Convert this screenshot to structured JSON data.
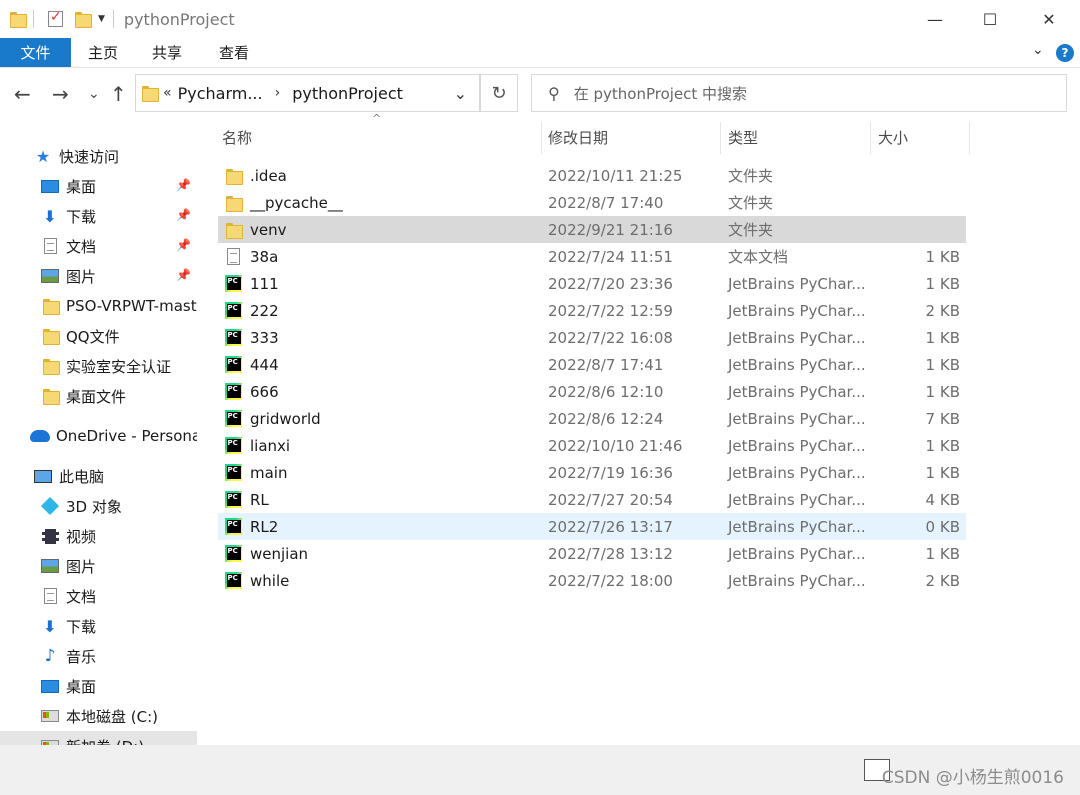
{
  "titlebar": {
    "title": "pythonProject",
    "minimize": "—",
    "maximize": "☐",
    "close": "✕"
  },
  "ribbon": {
    "tabs": [
      "文件",
      "主页",
      "共享",
      "查看"
    ],
    "expand": "⌄",
    "help": "?"
  },
  "nav": {
    "back": "←",
    "forward": "→",
    "recent": "⌄",
    "up": "↑",
    "address_prefix": "«",
    "breadcrumb": [
      "Pycharm...",
      "pythonProject"
    ],
    "address_dropdown": "⌄",
    "refresh": "↻",
    "search_placeholder": "在 pythonProject 中搜索"
  },
  "sidebar": {
    "items": [
      {
        "label": "快速访问",
        "icon": "star-icon"
      },
      {
        "label": "桌面",
        "icon": "desktop-icon",
        "pinned": true
      },
      {
        "label": "下载",
        "icon": "download-icon",
        "pinned": true
      },
      {
        "label": "文档",
        "icon": "document-icon",
        "pinned": true
      },
      {
        "label": "图片",
        "icon": "pictures-icon",
        "pinned": true
      },
      {
        "label": "PSO-VRPWT-mast",
        "icon": "folder-icon"
      },
      {
        "label": "QQ文件",
        "icon": "folder-icon"
      },
      {
        "label": "实验室安全认证",
        "icon": "folder-icon"
      },
      {
        "label": "桌面文件",
        "icon": "folder-icon"
      },
      {
        "label": "OneDrive - Persona",
        "icon": "onedrive-icon"
      },
      {
        "label": "此电脑",
        "icon": "this-pc-icon"
      },
      {
        "label": "3D 对象",
        "icon": "3d-objects-icon"
      },
      {
        "label": "视频",
        "icon": "videos-icon"
      },
      {
        "label": "图片",
        "icon": "pictures-icon"
      },
      {
        "label": "文档",
        "icon": "document-icon"
      },
      {
        "label": "下载",
        "icon": "download-icon"
      },
      {
        "label": "音乐",
        "icon": "music-icon"
      },
      {
        "label": "桌面",
        "icon": "desktop-icon"
      },
      {
        "label": "本地磁盘 (C:)",
        "icon": "local-disk-icon"
      },
      {
        "label": "新加卷 (D:)",
        "icon": "drive-icon"
      }
    ]
  },
  "columns": {
    "name": "名称",
    "date": "修改日期",
    "type": "类型",
    "size": "大小",
    "sort_indicator": "^"
  },
  "files": [
    {
      "name": ".idea",
      "date": "2022/10/11 21:25",
      "type": "文件夹",
      "size": "",
      "icon": "folder-icon"
    },
    {
      "name": "__pycache__",
      "date": "2022/8/7 17:40",
      "type": "文件夹",
      "size": "",
      "icon": "folder-icon"
    },
    {
      "name": "venv",
      "date": "2022/9/21 21:16",
      "type": "文件夹",
      "size": "",
      "icon": "folder-icon",
      "state": "hover"
    },
    {
      "name": "38a",
      "date": "2022/7/24 11:51",
      "type": "文本文档",
      "size": "1 KB",
      "icon": "text-file-icon"
    },
    {
      "name": "111",
      "date": "2022/7/20 23:36",
      "type": "JetBrains PyChar...",
      "size": "1 KB",
      "icon": "pycharm-file-icon"
    },
    {
      "name": "222",
      "date": "2022/7/22 12:59",
      "type": "JetBrains PyChar...",
      "size": "2 KB",
      "icon": "pycharm-file-icon"
    },
    {
      "name": "333",
      "date": "2022/7/22 16:08",
      "type": "JetBrains PyChar...",
      "size": "1 KB",
      "icon": "pycharm-file-icon"
    },
    {
      "name": "444",
      "date": "2022/8/7 17:41",
      "type": "JetBrains PyChar...",
      "size": "1 KB",
      "icon": "pycharm-file-icon"
    },
    {
      "name": "666",
      "date": "2022/8/6 12:10",
      "type": "JetBrains PyChar...",
      "size": "1 KB",
      "icon": "pycharm-file-icon"
    },
    {
      "name": "gridworld",
      "date": "2022/8/6 12:24",
      "type": "JetBrains PyChar...",
      "size": "7 KB",
      "icon": "pycharm-file-icon"
    },
    {
      "name": "lianxi",
      "date": "2022/10/10 21:46",
      "type": "JetBrains PyChar...",
      "size": "1 KB",
      "icon": "pycharm-file-icon"
    },
    {
      "name": "main",
      "date": "2022/7/19 16:36",
      "type": "JetBrains PyChar...",
      "size": "1 KB",
      "icon": "pycharm-file-icon"
    },
    {
      "name": "RL",
      "date": "2022/7/27 20:54",
      "type": "JetBrains PyChar...",
      "size": "4 KB",
      "icon": "pycharm-file-icon"
    },
    {
      "name": "RL2",
      "date": "2022/7/26 13:17",
      "type": "JetBrains PyChar...",
      "size": "0 KB",
      "icon": "pycharm-file-icon",
      "state": "selected"
    },
    {
      "name": "wenjian",
      "date": "2022/7/28 13:12",
      "type": "JetBrains PyChar...",
      "size": "1 KB",
      "icon": "pycharm-file-icon"
    },
    {
      "name": "while",
      "date": "2022/7/22 18:00",
      "type": "JetBrains PyChar...",
      "size": "2 KB",
      "icon": "pycharm-file-icon"
    }
  ],
  "statusbar": {
    "watermark": "CSDN @小杨生煎0016"
  },
  "colors": {
    "accent": "#1979ca",
    "hover_row": "#d9d9d9",
    "selected_row": "#e5f3ff",
    "folder": "#f8d775"
  }
}
